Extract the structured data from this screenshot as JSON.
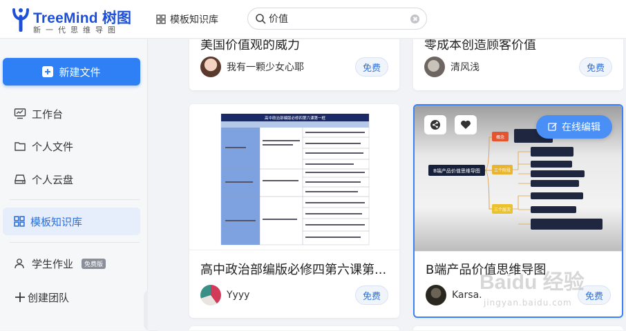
{
  "header": {
    "logo_name": "TreeMind 树图",
    "logo_slogan": "新一代思维导图",
    "nav_templates_label": "模板知识库",
    "search_value": "价值"
  },
  "sidebar": {
    "new_file_label": "新建文件",
    "items": [
      {
        "label": "工作台",
        "icon": "monitor-icon"
      },
      {
        "label": "个人文件",
        "icon": "folder-icon"
      },
      {
        "label": "个人云盘",
        "icon": "cloud-disk-icon"
      },
      {
        "label": "模板知识库",
        "icon": "grid-icon",
        "active": true
      },
      {
        "label": "学生作业",
        "icon": "user-icon",
        "badge": "免费版"
      },
      {
        "label": "创建团队",
        "icon": "plus-icon"
      }
    ]
  },
  "cards": [
    {
      "title": "美国价值观的威力",
      "author": "我有一颗少女心耶",
      "price": "免费"
    },
    {
      "title": "零成本创造顾客价值",
      "author": "清风浅",
      "price": "免费"
    },
    {
      "title": "高中政治部编版必修四第六课第...",
      "author": "Yyyy",
      "price": "免费",
      "thumb_title": "高中政治部编版必修四第六课第一框"
    },
    {
      "title": "B端产品价值思维导图",
      "author": "Karsa.",
      "price": "免费",
      "edit_label": "在线编辑",
      "thumb_root": "B端产品价值思维导图",
      "thumb_nodes": [
        "概念",
        "三个阶段",
        "三个层次"
      ]
    }
  ],
  "watermark": "Baidu 经验",
  "watermark_sub": "jingyan.baidu.com",
  "colors": {
    "accent": "#2f80f5",
    "active_bg": "#e6edfb",
    "pill_text": "#2f6fd8"
  }
}
